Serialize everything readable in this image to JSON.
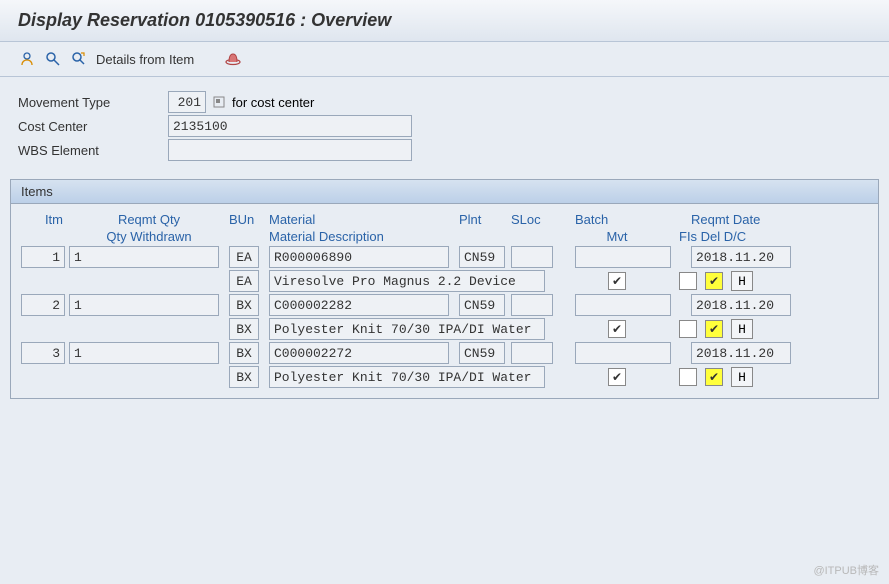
{
  "header": {
    "title": "Display Reservation 0105390516 : Overview"
  },
  "toolbar": {
    "details_from_item": "Details from Item"
  },
  "form": {
    "movement_type_label": "Movement Type",
    "movement_type_value": "201",
    "movement_type_text": "for cost center",
    "cost_center_label": "Cost Center",
    "cost_center_value": "2135100",
    "wbs_label": "WBS Element",
    "wbs_value": ""
  },
  "panel": {
    "title": "Items"
  },
  "columns": {
    "itm": "Itm",
    "reqmt_qty": "Reqmt Qty",
    "bun": "BUn",
    "material": "Material",
    "plnt": "Plnt",
    "sloc": "SLoc",
    "batch": "Batch",
    "reqmt_date": "Reqmt Date",
    "qty_withdrawn": "Qty Withdrawn",
    "material_desc": "Material Description",
    "mvt": "Mvt",
    "fis_del_dc": "FIs Del D/C"
  },
  "rows": [
    {
      "itm": "1",
      "qty": "1",
      "bun": "EA",
      "material": "R000006890",
      "plnt": "CN59",
      "sloc": "",
      "batch": "",
      "date": "2018.11.20",
      "bun2": "EA",
      "desc": "Viresolve Pro Magnus 2.2 Device",
      "mvt_check": true,
      "fis_check": false,
      "del_check": true,
      "dc": "H"
    },
    {
      "itm": "2",
      "qty": "1",
      "bun": "BX",
      "material": "C000002282",
      "plnt": "CN59",
      "sloc": "",
      "batch": "",
      "date": "2018.11.20",
      "bun2": "BX",
      "desc": "Polyester Knit 70/30 IPA/DI Water",
      "mvt_check": true,
      "fis_check": false,
      "del_check": true,
      "dc": "H"
    },
    {
      "itm": "3",
      "qty": "1",
      "bun": "BX",
      "material": "C000002272",
      "plnt": "CN59",
      "sloc": "",
      "batch": "",
      "date": "2018.11.20",
      "bun2": "BX",
      "desc": "Polyester Knit 70/30 IPA/DI Water",
      "mvt_check": true,
      "fis_check": false,
      "del_check": true,
      "dc": "H"
    }
  ],
  "watermark": "@ITPUB博客"
}
